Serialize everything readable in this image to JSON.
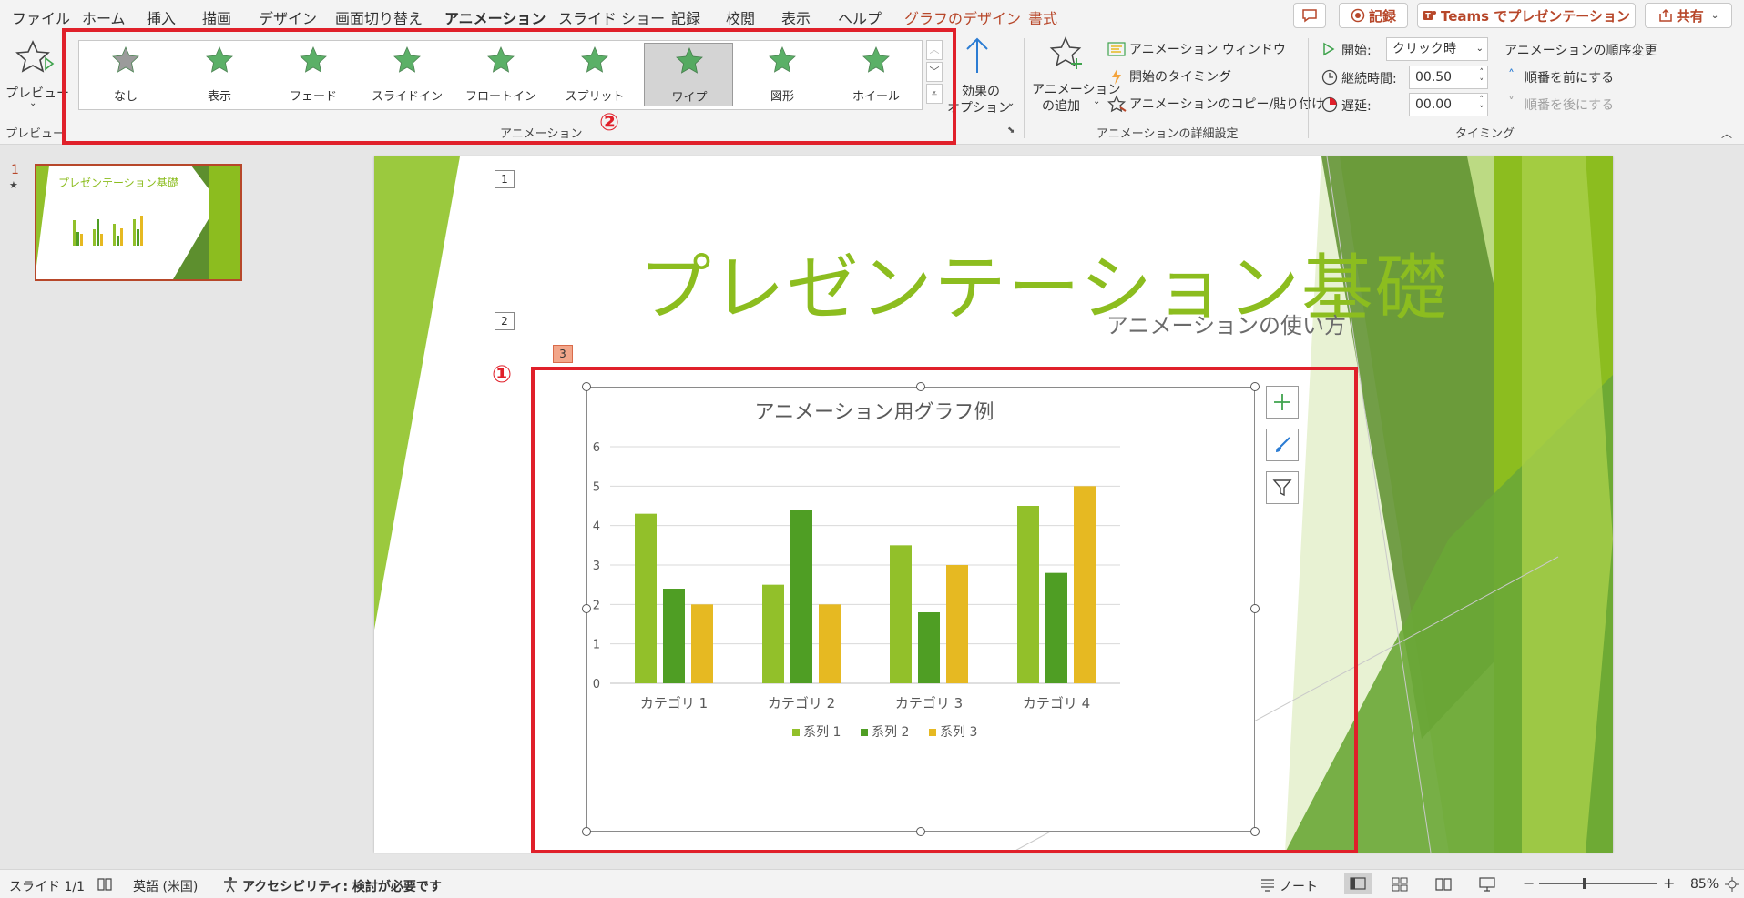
{
  "menu": {
    "items": [
      "ファイル",
      "ホーム",
      "挿入",
      "描画",
      "デザイン",
      "画面切り替え",
      "アニメーション",
      "スライド ショー",
      "記録",
      "校閲",
      "表示",
      "ヘルプ",
      "グラフのデザイン",
      "書式"
    ],
    "active": "アニメーション",
    "contextual": [
      "グラフのデザイン",
      "書式"
    ]
  },
  "topbar": {
    "record": "記録",
    "teams": "Teams でプレゼンテーション",
    "share": "共有"
  },
  "ribbon": {
    "preview": {
      "button": "プレビュー",
      "group": "プレビュー"
    },
    "animation_group": "アニメーション",
    "gallery": [
      {
        "label": "なし",
        "color": "#8a8a8a"
      },
      {
        "label": "表示",
        "color": "#3fa34d"
      },
      {
        "label": "フェード",
        "color": "#3fa34d"
      },
      {
        "label": "スライドイン",
        "color": "#3fa34d"
      },
      {
        "label": "フロートイン",
        "color": "#3fa34d"
      },
      {
        "label": "スプリット",
        "color": "#3fa34d"
      },
      {
        "label": "ワイプ",
        "color": "#3fa34d"
      },
      {
        "label": "図形",
        "color": "#3fa34d"
      },
      {
        "label": "ホイール",
        "color": "#3fa34d"
      }
    ],
    "gallery_selected": "ワイプ",
    "effect_options": [
      "効果の",
      "オプション"
    ],
    "add_animation": [
      "アニメーション",
      "の追加"
    ],
    "advanced": {
      "pane": "アニメーション ウィンドウ",
      "trigger": "開始のタイミング",
      "painter": "アニメーションのコピー/貼り付け",
      "group": "アニメーションの詳細設定"
    },
    "timing": {
      "start_label": "開始:",
      "start_value": "クリック時",
      "duration_label": "継続時間:",
      "duration_value": "00.50",
      "delay_label": "遅延:",
      "delay_value": "00.00",
      "reorder_title": "アニメーションの順序変更",
      "move_earlier": "順番を前にする",
      "move_later": "順番を後にする",
      "group": "タイミング"
    }
  },
  "thumbnail": {
    "number": "1",
    "star": "★",
    "title": "プレゼンテーション基礎"
  },
  "slide": {
    "title": "プレゼンテーション基礎",
    "subtitle": "アニメーションの使い方",
    "tags": [
      "1",
      "2",
      "3"
    ],
    "callout_1": "①",
    "callout_2": "②"
  },
  "chart_data": {
    "type": "bar",
    "title": "アニメーション用グラフ例",
    "categories": [
      "カテゴリ 1",
      "カテゴリ 2",
      "カテゴリ 3",
      "カテゴリ 4"
    ],
    "series": [
      {
        "name": "系列 1",
        "values": [
          4.3,
          2.5,
          3.5,
          4.5
        ],
        "color": "#92c02a"
      },
      {
        "name": "系列 2",
        "values": [
          2.4,
          4.4,
          1.8,
          2.8
        ],
        "color": "#4f9e24"
      },
      {
        "name": "系列 3",
        "values": [
          2.0,
          2.0,
          3.0,
          5.0
        ],
        "color": "#e6b922"
      }
    ],
    "ylim": [
      0,
      6
    ],
    "yticks": [
      "0",
      "1",
      "2",
      "3",
      "4",
      "5",
      "6"
    ],
    "grid": true,
    "legend": "bottom"
  },
  "status": {
    "slide": "スライド 1/1",
    "language": "英語 (米国)",
    "accessibility": "アクセシビリティ: 検討が必要です",
    "notes": "ノート",
    "zoom": "85%"
  },
  "colors": {
    "accent": "#b7472a",
    "callout": "#e0202a",
    "title_green": "#8cbd1f"
  }
}
